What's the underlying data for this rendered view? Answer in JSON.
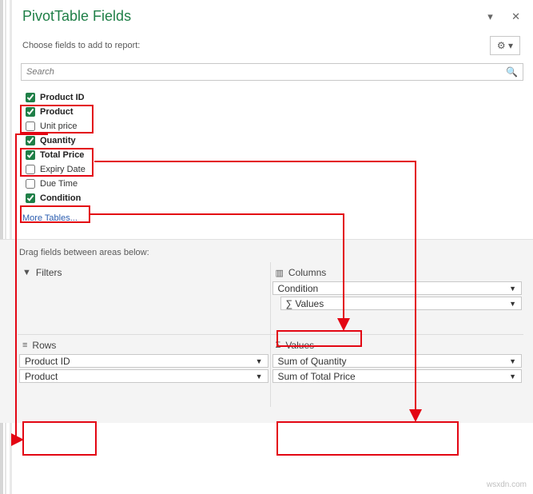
{
  "header": {
    "title": "PivotTable Fields",
    "subtitle": "Choose fields to add to report:"
  },
  "search": {
    "placeholder": "Search"
  },
  "fields": [
    {
      "label": "Product ID",
      "checked": true,
      "bold": true
    },
    {
      "label": "Product",
      "checked": true,
      "bold": true
    },
    {
      "label": "Unit price",
      "checked": false,
      "bold": false
    },
    {
      "label": "Quantity",
      "checked": true,
      "bold": true
    },
    {
      "label": "Total Price",
      "checked": true,
      "bold": true
    },
    {
      "label": "Expiry Date",
      "checked": false,
      "bold": false
    },
    {
      "label": "Due Time",
      "checked": false,
      "bold": false
    },
    {
      "label": "Condition",
      "checked": true,
      "bold": true
    }
  ],
  "more_tables": "More Tables...",
  "areas_label": "Drag fields between areas below:",
  "areas": {
    "filters": {
      "title": "Filters",
      "items": []
    },
    "columns": {
      "title": "Columns",
      "items": [
        "Condition",
        "∑  Values"
      ]
    },
    "rows": {
      "title": "Rows",
      "items": [
        "Product ID",
        "Product"
      ]
    },
    "values": {
      "title": "Values",
      "items": [
        "Sum of Quantity",
        "Sum of Total Price"
      ]
    }
  },
  "watermark": "wsxdn.com"
}
